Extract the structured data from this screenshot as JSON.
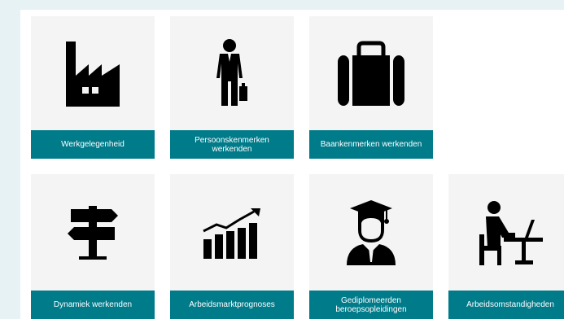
{
  "tiles": [
    {
      "label": "Werkgelegenheid",
      "icon": "factory-icon"
    },
    {
      "label": "Persoonskenmerken werkenden",
      "icon": "businessman-icon"
    },
    {
      "label": "Baankenmerken werkenden",
      "icon": "briefcase-icon"
    },
    {
      "label": "Dynamiek werkenden",
      "icon": "signpost-icon"
    },
    {
      "label": "Arbeidsmarktprognoses",
      "icon": "growth-chart-icon"
    },
    {
      "label": "Gediplomeerden beroepsopleidingen",
      "icon": "graduate-icon"
    },
    {
      "label": "Arbeidsomstandigheden",
      "icon": "desk-worker-icon"
    }
  ],
  "colors": {
    "page_background": "#e6f2f3",
    "tile_background": "#f4f4f4",
    "label_background": "#007b8a",
    "label_text": "#ffffff",
    "icon": "#000000"
  }
}
